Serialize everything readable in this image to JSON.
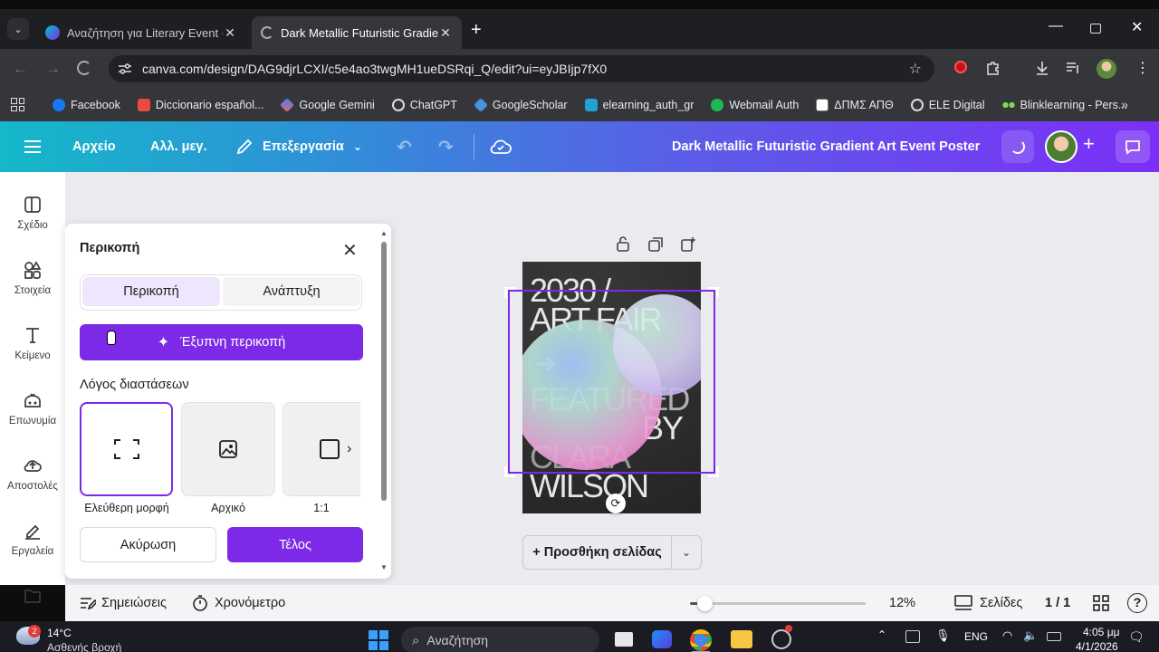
{
  "browser": {
    "tabs": [
      {
        "title": "Αναζήτηση για Literary Event -",
        "active": false
      },
      {
        "title": "Dark Metallic Futuristic Gradien",
        "active": true
      }
    ],
    "url": "canva.com/design/DAG9djrLCXI/c5e4ao3twgMH1ueDSRqi_Q/edit?ui=eyJBIjp7fX0",
    "bookmarks": [
      "Facebook",
      "Diccionario español...",
      "Google Gemini",
      "ChatGPT",
      "GoogleScholar",
      "elearning_auth_gr",
      "Webmail Auth",
      "ΔΠΜΣ ΑΠΘ",
      "ELE Digital",
      "Blinklearning - Pers..."
    ]
  },
  "header": {
    "file": "Αρχείο",
    "resize": "Αλλ. μεγ.",
    "edit": "Επεξεργασία",
    "doc_title": "Dark Metallic Futuristic Gradient Art Event Poster"
  },
  "sidebar": [
    {
      "label": "Σχέδιο",
      "icon": "layout-icon"
    },
    {
      "label": "Στοιχεία",
      "icon": "elements-icon"
    },
    {
      "label": "Κείμενο",
      "icon": "text-icon"
    },
    {
      "label": "Επωνυμία",
      "icon": "brand-icon"
    },
    {
      "label": "Αποστολές",
      "icon": "upload-icon"
    },
    {
      "label": "Εργαλεία",
      "icon": "tools-icon"
    }
  ],
  "crop_panel": {
    "title": "Περικοπή",
    "tabs": [
      "Περικοπή",
      "Ανάπτυξη"
    ],
    "smart_crop": "Έξυπνη περικοπή",
    "aspect_title": "Λόγος διαστάσεων",
    "options": [
      "Ελεύθερη μορφή",
      "Αρχικό",
      "1:1"
    ],
    "cancel": "Ακύρωση",
    "done": "Τέλος"
  },
  "poster": {
    "lines": [
      "2030 /",
      "ART FAIR",
      "FEATURED",
      "BY",
      "CLARA",
      "WILSON"
    ]
  },
  "canvas": {
    "add_page": "+ Προσθήκη σελίδας"
  },
  "bottom": {
    "notes": "Σημειώσεις",
    "timer": "Χρονόμετρο",
    "zoom": "12%",
    "zoom_fraction": 0.08,
    "pages_label": "Σελίδες",
    "pages": "1 / 1"
  },
  "taskbar": {
    "weather_badge": "2",
    "temp": "14°C",
    "weather": "Ασθενής βροχή",
    "search": "Αναζήτηση",
    "lang": "ENG",
    "time": "4:05 μμ",
    "date": "4/1/2026"
  },
  "colors": {
    "accent": "#7d2ae8",
    "selected_tab_bg": "#ede6fd",
    "header_start": "#15b8c9",
    "header_end": "#7b2ff7"
  }
}
